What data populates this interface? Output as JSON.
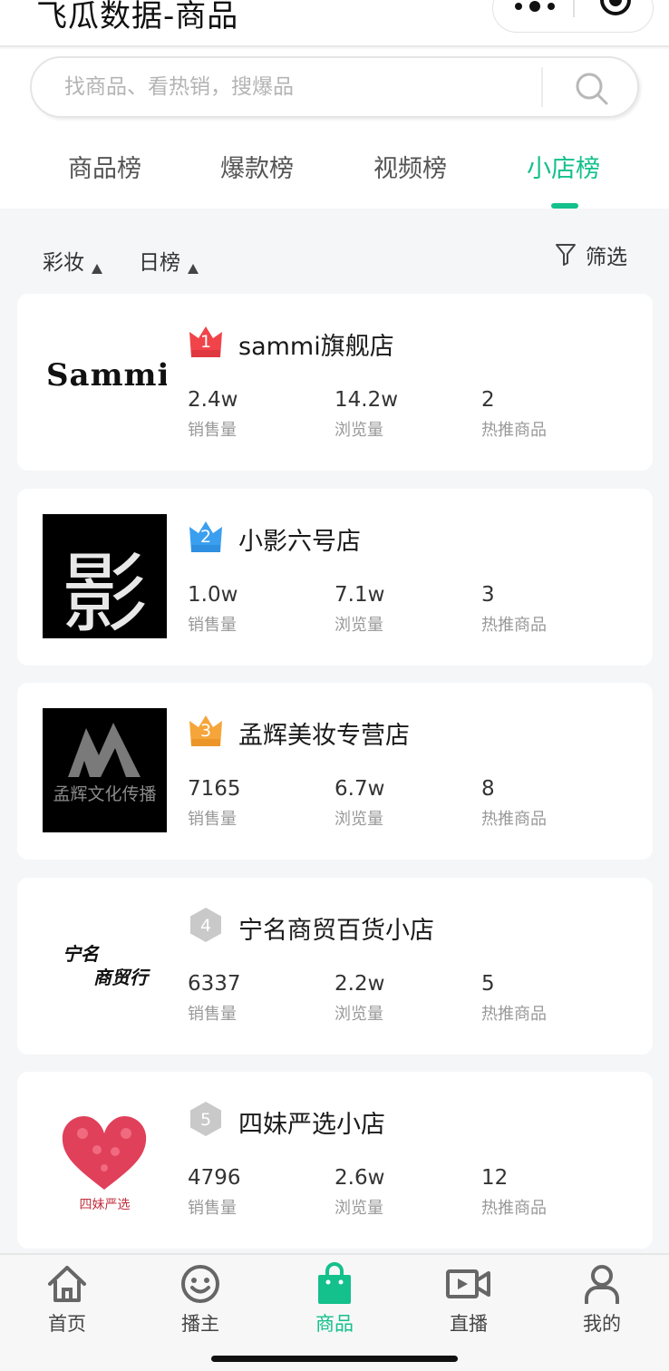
{
  "app": {
    "title": "飞瓜数据-商品"
  },
  "search": {
    "placeholder": "找商品、看热销，搜爆品"
  },
  "tabs": [
    {
      "label": "商品榜",
      "active": false
    },
    {
      "label": "爆款榜",
      "active": false
    },
    {
      "label": "视频榜",
      "active": false
    },
    {
      "label": "小店榜",
      "active": true
    }
  ],
  "filters": {
    "category": "彩妆",
    "period": "日榜",
    "filter_label": "筛选"
  },
  "stat_labels": {
    "sales": "销售量",
    "views": "浏览量",
    "hot_products": "热推商品"
  },
  "shops": [
    {
      "rank": "1",
      "name": "sammi旗舰店",
      "logo_text": "Sammi",
      "sales": "2.4w",
      "views": "14.2w",
      "hot_products": "2",
      "badge_color": "#f0444a"
    },
    {
      "rank": "2",
      "name": "小影六号店",
      "logo_text": "影",
      "sales": "1.0w",
      "views": "7.1w",
      "hot_products": "3",
      "badge_color": "#3b9ff0"
    },
    {
      "rank": "3",
      "name": "孟辉美妆专营店",
      "logo_text": "孟辉文化传播",
      "sales": "7165",
      "views": "6.7w",
      "hot_products": "8",
      "badge_color": "#f5a53a"
    },
    {
      "rank": "4",
      "name": "宁名商贸百货小店",
      "logo_text_1": "宁名",
      "logo_text_2": "商贸行",
      "sales": "6337",
      "views": "2.2w",
      "hot_products": "5",
      "badge_color": "#c9c9c9"
    },
    {
      "rank": "5",
      "name": "四妹严选小店",
      "logo_text": "四妹严选",
      "sales": "4796",
      "views": "2.6w",
      "hot_products": "12",
      "badge_color": "#c9c9c9"
    }
  ],
  "bottom_nav": [
    {
      "label": "首页",
      "icon": "home-icon",
      "active": false
    },
    {
      "label": "播主",
      "icon": "smile-icon",
      "active": false
    },
    {
      "label": "商品",
      "icon": "shopping-bag-icon",
      "active": true
    },
    {
      "label": "直播",
      "icon": "video-camera-icon",
      "active": false
    },
    {
      "label": "我的",
      "icon": "user-icon",
      "active": false
    }
  ],
  "colors": {
    "accent": "#14c08c",
    "rank1": "#f0444a",
    "rank2": "#3b9ff0",
    "rank3": "#f5a53a",
    "rank_other": "#c9c9c9"
  }
}
